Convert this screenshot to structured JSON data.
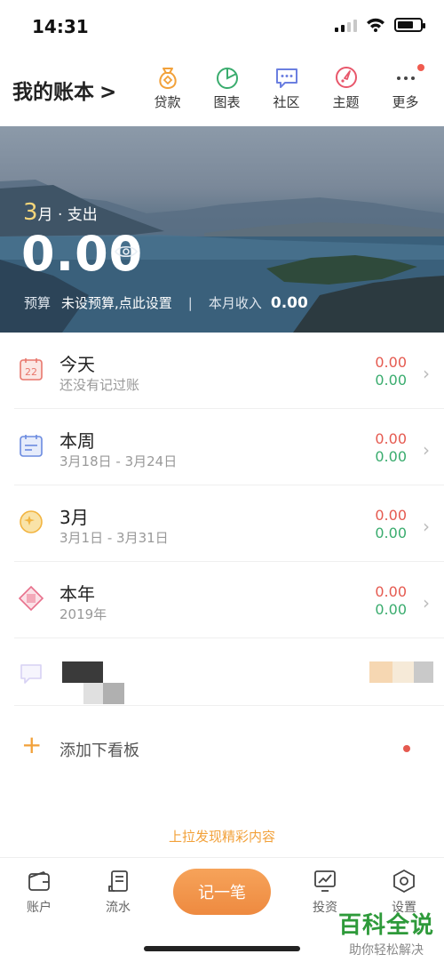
{
  "status": {
    "time": "14:31"
  },
  "header": {
    "book_title": "我的账本",
    "book_chevron": ">",
    "nav": [
      {
        "label": "贷款",
        "icon": "loan-bag-icon"
      },
      {
        "label": "图表",
        "icon": "pie-chart-icon"
      },
      {
        "label": "社区",
        "icon": "community-chat-icon"
      },
      {
        "label": "主题",
        "icon": "theme-palette-icon"
      },
      {
        "label": "更多",
        "icon": "more-dots-icon"
      }
    ]
  },
  "hero": {
    "month": "3",
    "period_suffix": "月 · 支出",
    "amount": "0.00",
    "budget_label": "预算",
    "budget_value": "未设预算,点此设置",
    "separator": "|",
    "income_label": "本月收入",
    "income_value": "0.00"
  },
  "rows": [
    {
      "title": "今天",
      "subtitle": "还没有记过账",
      "expense": "0.00",
      "income": "0.00",
      "icon": "calendar-22-icon",
      "icon_text": "22"
    },
    {
      "title": "本周",
      "subtitle": "3月18日 - 3月24日",
      "expense": "0.00",
      "income": "0.00",
      "icon": "week-calendar-icon"
    },
    {
      "title": "3月",
      "subtitle": "3月1日 - 3月31日",
      "expense": "0.00",
      "income": "0.00",
      "icon": "moon-icon"
    },
    {
      "title": "本年",
      "subtitle": "2019年",
      "expense": "0.00",
      "income": "0.00",
      "icon": "year-diamond-icon"
    }
  ],
  "add_board": {
    "label": "添加下看板"
  },
  "pull_hint": "上拉发现精彩内容",
  "tabbar": {
    "tabs": [
      {
        "label": "账户",
        "icon": "wallet-icon"
      },
      {
        "label": "流水",
        "icon": "ledger-icon"
      },
      {
        "label": "投资",
        "icon": "investment-chart-icon"
      },
      {
        "label": "设置",
        "icon": "settings-hexagon-icon"
      }
    ],
    "record_label": "记一笔"
  },
  "watermark": {
    "title": "百科全说",
    "subtitle": "助你轻松解决"
  },
  "colors": {
    "accent": "#f2a13a",
    "expense": "#e55a50",
    "income": "#3aac6e"
  }
}
